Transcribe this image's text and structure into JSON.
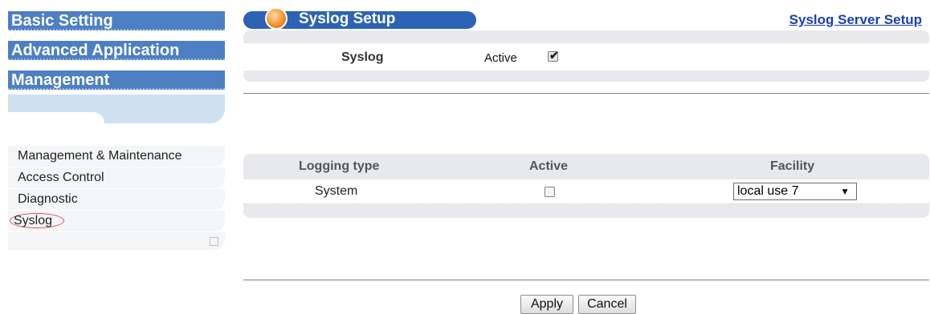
{
  "sidebar": {
    "sections": [
      "Basic Setting",
      "Advanced Application",
      "Management"
    ],
    "items": [
      {
        "label": "Management & Maintenance"
      },
      {
        "label": "Access Control"
      },
      {
        "label": "Diagnostic"
      },
      {
        "label": "Syslog"
      }
    ]
  },
  "header": {
    "title": "Syslog Setup",
    "server_link": "Syslog Server Setup"
  },
  "syslog": {
    "label": "Syslog",
    "active_label": "Active",
    "active_checked": true
  },
  "logging": {
    "columns": [
      "Logging type",
      "Active",
      "Facility"
    ],
    "rows": [
      {
        "type": "System",
        "active": false,
        "facility": "local use 7"
      }
    ]
  },
  "buttons": {
    "apply": "Apply",
    "cancel": "Cancel"
  },
  "icons": {
    "title_ball": "orange-ball-icon",
    "dropdown": "dropdown-arrow-icon",
    "checkbox": "checkbox-icon"
  },
  "colors": {
    "nav_blue": "#4d7fc4",
    "title_blue": "#2d63b5",
    "link_blue": "#1a3fb4",
    "panel_gray": "#e7e9ec",
    "selected_circle": "#e24a4a"
  }
}
